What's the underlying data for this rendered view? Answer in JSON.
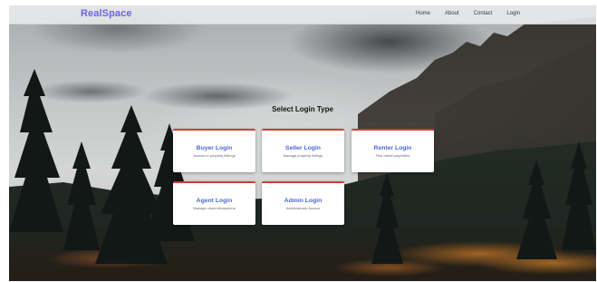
{
  "brand": "RealSpace",
  "nav": {
    "items": [
      {
        "label": "Home"
      },
      {
        "label": "About"
      },
      {
        "label": "Contact"
      },
      {
        "label": "Login"
      }
    ]
  },
  "main": {
    "heading": "Select Login Type",
    "cards": [
      {
        "title": "Buyer Login",
        "desc": "Access to property listings"
      },
      {
        "title": "Seller Login",
        "desc": "Manage property listings"
      },
      {
        "title": "Renter Login",
        "desc": "Find rental properties"
      },
      {
        "title": "Agent Login",
        "desc": "Manage client interactions"
      },
      {
        "title": "Admin Login",
        "desc": "Administrator Access"
      }
    ]
  },
  "colors": {
    "brand": "#6c63e8",
    "card_title": "#4a68d6",
    "card_accent": "#d63a3a"
  }
}
